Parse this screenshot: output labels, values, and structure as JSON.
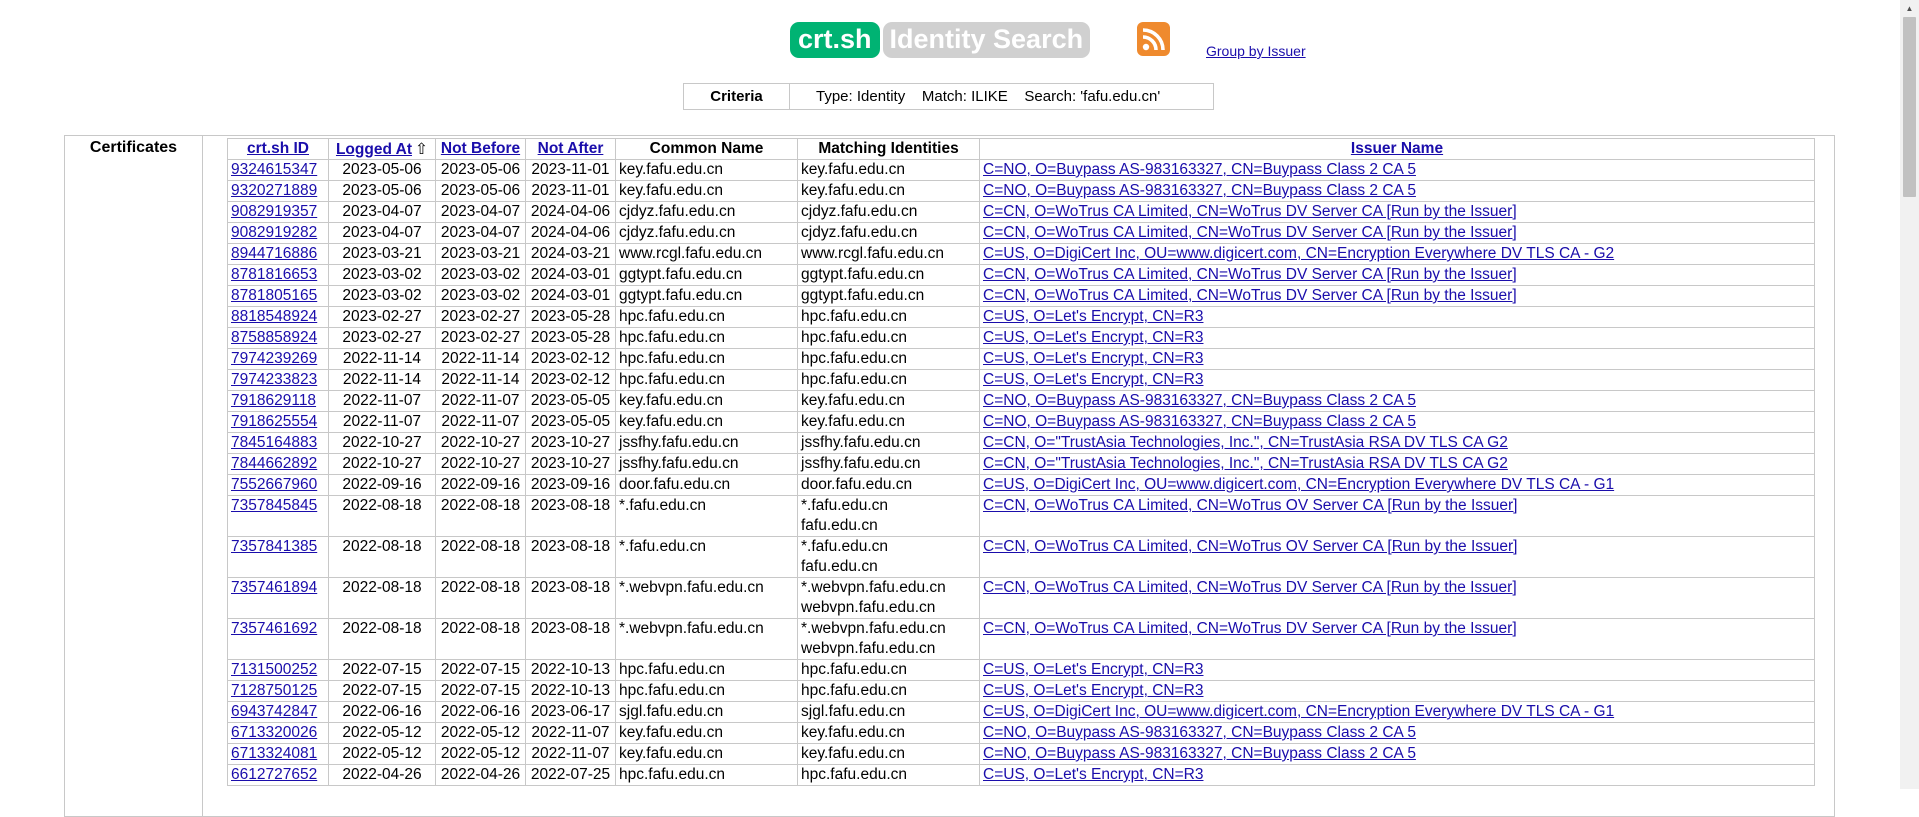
{
  "header": {
    "logo_primary": "crt.sh",
    "logo_secondary": "Identity Search",
    "rss_icon": "rss-feed-icon",
    "group_by_issuer": "Group by Issuer"
  },
  "criteria": {
    "label": "Criteria",
    "value": "Type: Identity    Match: ILIKE    Search: 'fafu.edu.cn'"
  },
  "certificates_label": "Certificates",
  "columns": {
    "id": "crt.sh ID",
    "logged_at": "Logged At",
    "sort_indicator": "⇧",
    "not_before": "Not Before",
    "not_after": "Not After",
    "common_name": "Common Name",
    "matching_identities": "Matching Identities",
    "issuer_name": "Issuer Name"
  },
  "rows": [
    {
      "id": "9324615347",
      "logged": "2023-05-06",
      "nb": "2023-05-06",
      "na": "2023-11-01",
      "cn": "key.fafu.edu.cn",
      "mi": [
        "key.fafu.edu.cn"
      ],
      "issuer": "C=NO, O=Buypass AS-983163327, CN=Buypass Class 2 CA 5"
    },
    {
      "id": "9320271889",
      "logged": "2023-05-06",
      "nb": "2023-05-06",
      "na": "2023-11-01",
      "cn": "key.fafu.edu.cn",
      "mi": [
        "key.fafu.edu.cn"
      ],
      "issuer": "C=NO, O=Buypass AS-983163327, CN=Buypass Class 2 CA 5"
    },
    {
      "id": "9082919357",
      "logged": "2023-04-07",
      "nb": "2023-04-07",
      "na": "2024-04-06",
      "cn": "cjdyz.fafu.edu.cn",
      "mi": [
        "cjdyz.fafu.edu.cn"
      ],
      "issuer": "C=CN, O=WoTrus CA Limited, CN=WoTrus DV Server CA  [Run by the Issuer]"
    },
    {
      "id": "9082919282",
      "logged": "2023-04-07",
      "nb": "2023-04-07",
      "na": "2024-04-06",
      "cn": "cjdyz.fafu.edu.cn",
      "mi": [
        "cjdyz.fafu.edu.cn"
      ],
      "issuer": "C=CN, O=WoTrus CA Limited, CN=WoTrus DV Server CA  [Run by the Issuer]"
    },
    {
      "id": "8944716886",
      "logged": "2023-03-21",
      "nb": "2023-03-21",
      "na": "2024-03-21",
      "cn": "www.rcgl.fafu.edu.cn",
      "mi": [
        "www.rcgl.fafu.edu.cn"
      ],
      "issuer": "C=US, O=DigiCert Inc, OU=www.digicert.com, CN=Encryption Everywhere DV TLS CA - G2"
    },
    {
      "id": "8781816653",
      "logged": "2023-03-02",
      "nb": "2023-03-02",
      "na": "2024-03-01",
      "cn": "ggtypt.fafu.edu.cn",
      "mi": [
        "ggtypt.fafu.edu.cn"
      ],
      "issuer": "C=CN, O=WoTrus CA Limited, CN=WoTrus DV Server CA  [Run by the Issuer]"
    },
    {
      "id": "8781805165",
      "logged": "2023-03-02",
      "nb": "2023-03-02",
      "na": "2024-03-01",
      "cn": "ggtypt.fafu.edu.cn",
      "mi": [
        "ggtypt.fafu.edu.cn"
      ],
      "issuer": "C=CN, O=WoTrus CA Limited, CN=WoTrus DV Server CA  [Run by the Issuer]"
    },
    {
      "id": "8818548924",
      "logged": "2023-02-27",
      "nb": "2023-02-27",
      "na": "2023-05-28",
      "cn": "hpc.fafu.edu.cn",
      "mi": [
        "hpc.fafu.edu.cn"
      ],
      "issuer": "C=US, O=Let's Encrypt, CN=R3"
    },
    {
      "id": "8758858924",
      "logged": "2023-02-27",
      "nb": "2023-02-27",
      "na": "2023-05-28",
      "cn": "hpc.fafu.edu.cn",
      "mi": [
        "hpc.fafu.edu.cn"
      ],
      "issuer": "C=US, O=Let's Encrypt, CN=R3"
    },
    {
      "id": "7974239269",
      "logged": "2022-11-14",
      "nb": "2022-11-14",
      "na": "2023-02-12",
      "cn": "hpc.fafu.edu.cn",
      "mi": [
        "hpc.fafu.edu.cn"
      ],
      "issuer": "C=US, O=Let's Encrypt, CN=R3"
    },
    {
      "id": "7974233823",
      "logged": "2022-11-14",
      "nb": "2022-11-14",
      "na": "2023-02-12",
      "cn": "hpc.fafu.edu.cn",
      "mi": [
        "hpc.fafu.edu.cn"
      ],
      "issuer": "C=US, O=Let's Encrypt, CN=R3"
    },
    {
      "id": "7918629118",
      "logged": "2022-11-07",
      "nb": "2022-11-07",
      "na": "2023-05-05",
      "cn": "key.fafu.edu.cn",
      "mi": [
        "key.fafu.edu.cn"
      ],
      "issuer": "C=NO, O=Buypass AS-983163327, CN=Buypass Class 2 CA 5"
    },
    {
      "id": "7918625554",
      "logged": "2022-11-07",
      "nb": "2022-11-07",
      "na": "2023-05-05",
      "cn": "key.fafu.edu.cn",
      "mi": [
        "key.fafu.edu.cn"
      ],
      "issuer": "C=NO, O=Buypass AS-983163327, CN=Buypass Class 2 CA 5"
    },
    {
      "id": "7845164883",
      "logged": "2022-10-27",
      "nb": "2022-10-27",
      "na": "2023-10-27",
      "cn": "jssfhy.fafu.edu.cn",
      "mi": [
        "jssfhy.fafu.edu.cn"
      ],
      "issuer": "C=CN, O=\"TrustAsia Technologies, Inc.\", CN=TrustAsia RSA DV TLS CA G2"
    },
    {
      "id": "7844662892",
      "logged": "2022-10-27",
      "nb": "2022-10-27",
      "na": "2023-10-27",
      "cn": "jssfhy.fafu.edu.cn",
      "mi": [
        "jssfhy.fafu.edu.cn"
      ],
      "issuer": "C=CN, O=\"TrustAsia Technologies, Inc.\", CN=TrustAsia RSA DV TLS CA G2"
    },
    {
      "id": "7552667960",
      "logged": "2022-09-16",
      "nb": "2022-09-16",
      "na": "2023-09-16",
      "cn": "door.fafu.edu.cn",
      "mi": [
        "door.fafu.edu.cn"
      ],
      "issuer": "C=US, O=DigiCert Inc, OU=www.digicert.com, CN=Encryption Everywhere DV TLS CA - G1"
    },
    {
      "id": "7357845845",
      "logged": "2022-08-18",
      "nb": "2022-08-18",
      "na": "2023-08-18",
      "cn": "*.fafu.edu.cn",
      "mi": [
        "*.fafu.edu.cn",
        "fafu.edu.cn"
      ],
      "issuer": "C=CN, O=WoTrus CA Limited, CN=WoTrus OV Server CA  [Run by the Issuer]"
    },
    {
      "id": "7357841385",
      "logged": "2022-08-18",
      "nb": "2022-08-18",
      "na": "2023-08-18",
      "cn": "*.fafu.edu.cn",
      "mi": [
        "*.fafu.edu.cn",
        "fafu.edu.cn"
      ],
      "issuer": "C=CN, O=WoTrus CA Limited, CN=WoTrus OV Server CA  [Run by the Issuer]"
    },
    {
      "id": "7357461894",
      "logged": "2022-08-18",
      "nb": "2022-08-18",
      "na": "2023-08-18",
      "cn": "*.webvpn.fafu.edu.cn",
      "mi": [
        "*.webvpn.fafu.edu.cn",
        "webvpn.fafu.edu.cn"
      ],
      "issuer": "C=CN, O=WoTrus CA Limited, CN=WoTrus DV Server CA  [Run by the Issuer]"
    },
    {
      "id": "7357461692",
      "logged": "2022-08-18",
      "nb": "2022-08-18",
      "na": "2023-08-18",
      "cn": "*.webvpn.fafu.edu.cn",
      "mi": [
        "*.webvpn.fafu.edu.cn",
        "webvpn.fafu.edu.cn"
      ],
      "issuer": "C=CN, O=WoTrus CA Limited, CN=WoTrus DV Server CA  [Run by the Issuer]"
    },
    {
      "id": "7131500252",
      "logged": "2022-07-15",
      "nb": "2022-07-15",
      "na": "2022-10-13",
      "cn": "hpc.fafu.edu.cn",
      "mi": [
        "hpc.fafu.edu.cn"
      ],
      "issuer": "C=US, O=Let's Encrypt, CN=R3"
    },
    {
      "id": "7128750125",
      "logged": "2022-07-15",
      "nb": "2022-07-15",
      "na": "2022-10-13",
      "cn": "hpc.fafu.edu.cn",
      "mi": [
        "hpc.fafu.edu.cn"
      ],
      "issuer": "C=US, O=Let's Encrypt, CN=R3"
    },
    {
      "id": "6943742847",
      "logged": "2022-06-16",
      "nb": "2022-06-16",
      "na": "2023-06-17",
      "cn": "sjgl.fafu.edu.cn",
      "mi": [
        "sjgl.fafu.edu.cn"
      ],
      "issuer": "C=US, O=DigiCert Inc, OU=www.digicert.com, CN=Encryption Everywhere DV TLS CA - G1"
    },
    {
      "id": "6713320026",
      "logged": "2022-05-12",
      "nb": "2022-05-12",
      "na": "2022-11-07",
      "cn": "key.fafu.edu.cn",
      "mi": [
        "key.fafu.edu.cn"
      ],
      "issuer": "C=NO, O=Buypass AS-983163327, CN=Buypass Class 2 CA 5"
    },
    {
      "id": "6713324081",
      "logged": "2022-05-12",
      "nb": "2022-05-12",
      "na": "2022-11-07",
      "cn": "key.fafu.edu.cn",
      "mi": [
        "key.fafu.edu.cn"
      ],
      "issuer": "C=NO, O=Buypass AS-983163327, CN=Buypass Class 2 CA 5"
    },
    {
      "id": "6612727652",
      "logged": "2022-04-26",
      "nb": "2022-04-26",
      "na": "2022-07-25",
      "cn": "hpc.fafu.edu.cn",
      "mi": [
        "hpc.fafu.edu.cn"
      ],
      "issuer": "C=US, O=Let's Encrypt, CN=R3"
    }
  ],
  "colors": {
    "logo_green": "#00b373",
    "logo_grey": "#d0d0d0",
    "rss_orange": "#ef8a2e",
    "link_blue": "#1a0dab",
    "border_grey": "#c8c8c8"
  }
}
